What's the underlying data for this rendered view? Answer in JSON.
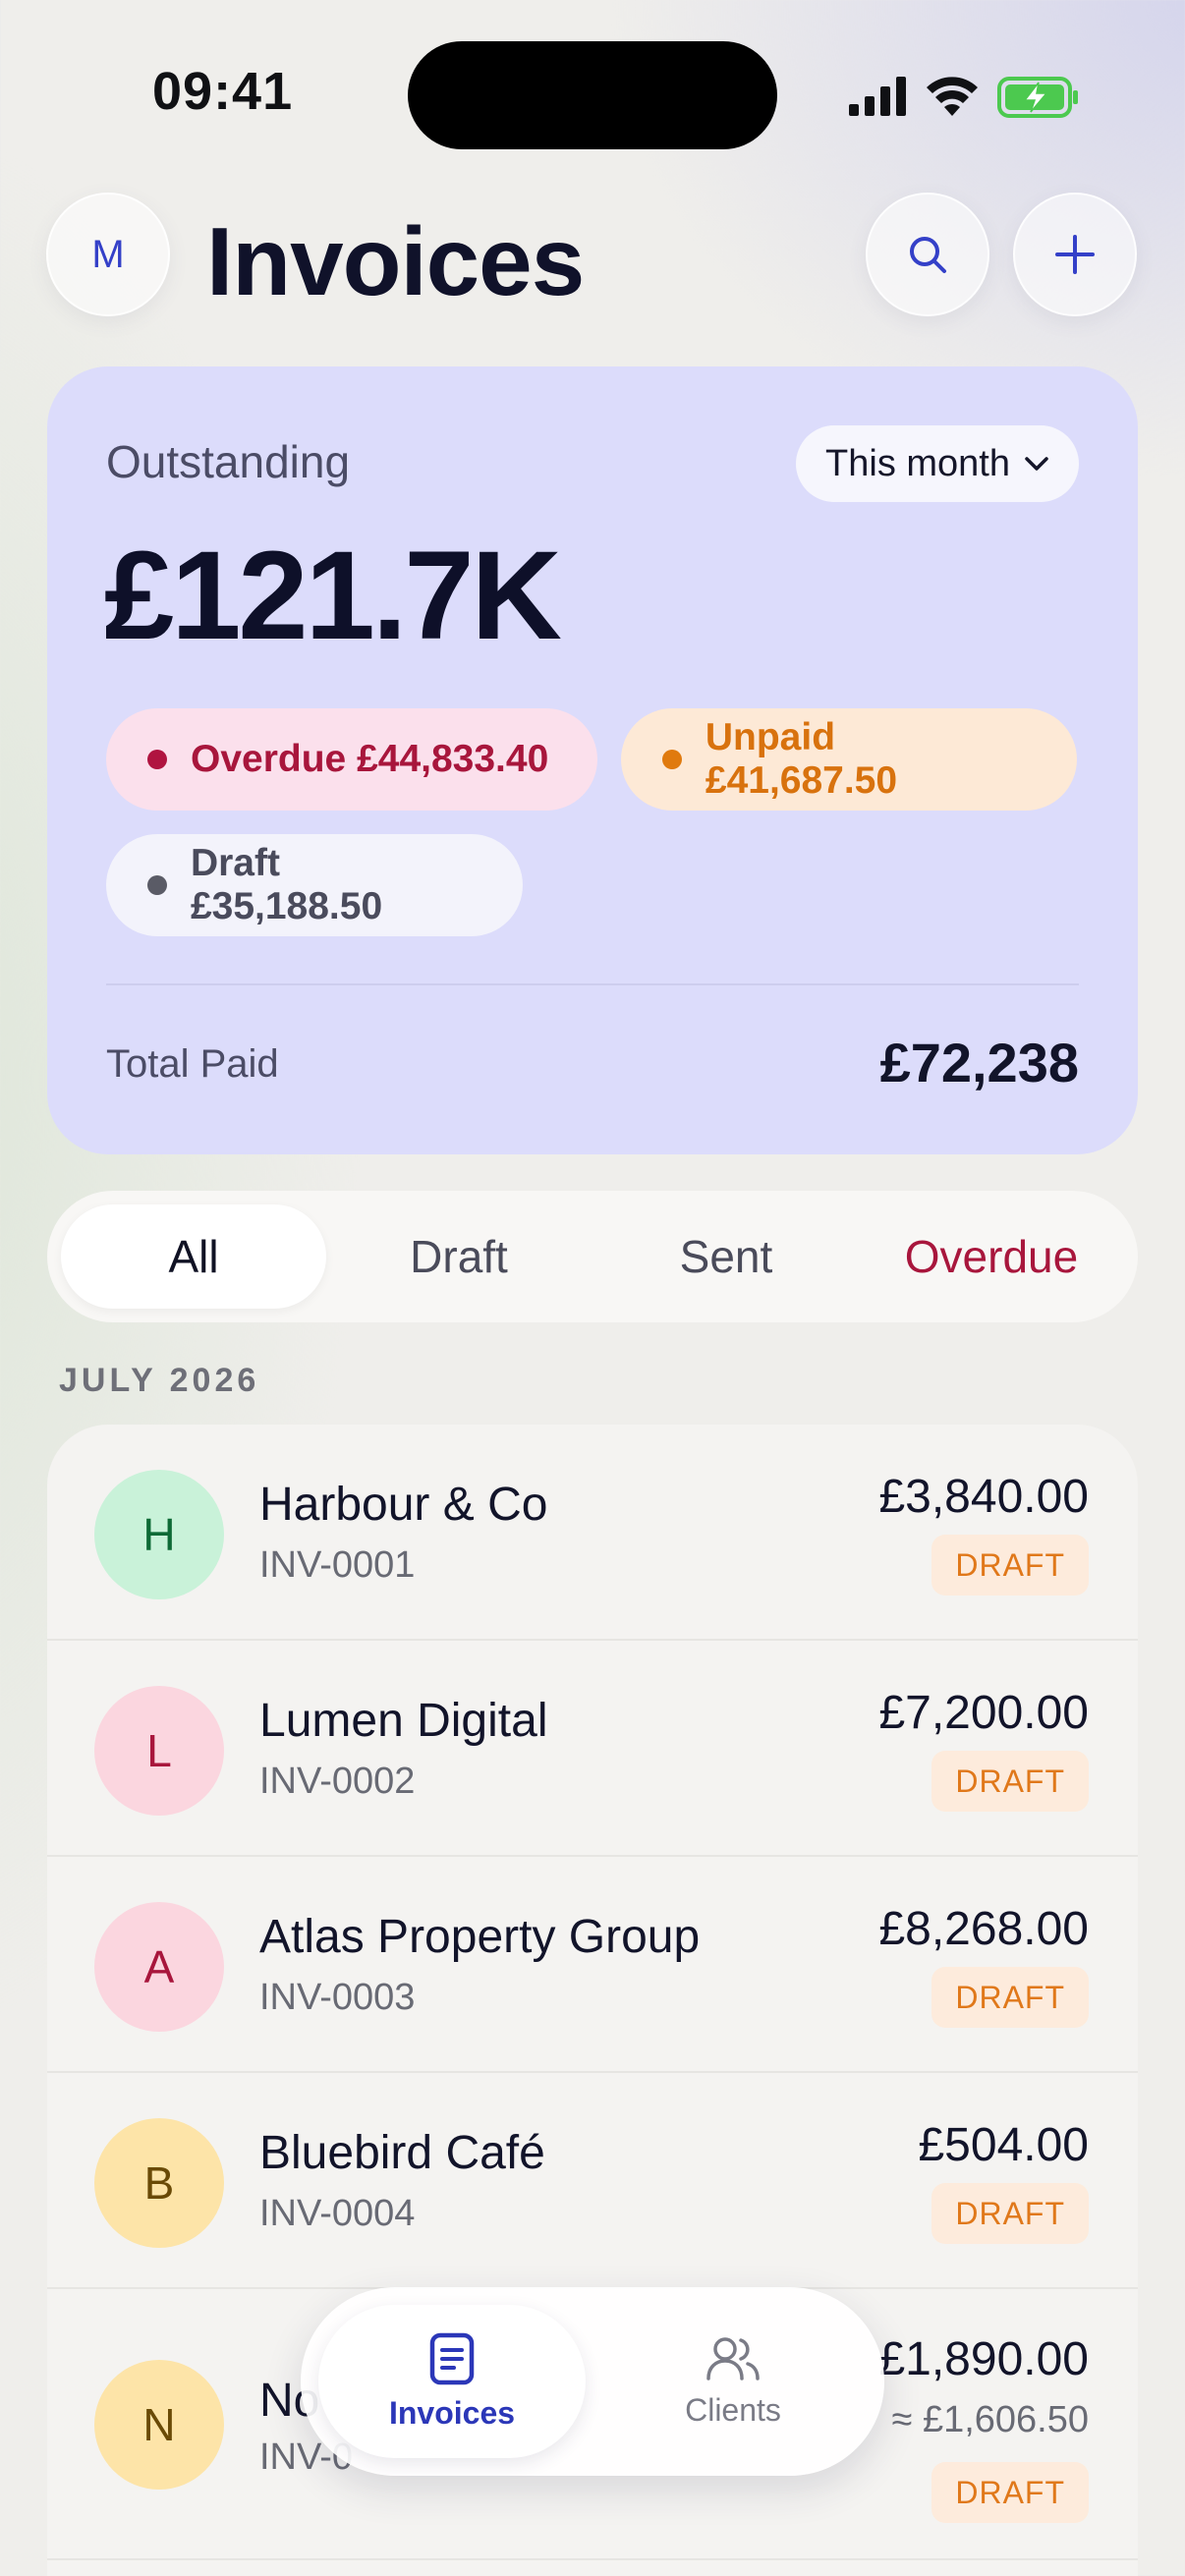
{
  "status_bar": {
    "time": "09:41"
  },
  "header": {
    "avatar_initial": "M",
    "title": "Invoices"
  },
  "summary": {
    "label": "Outstanding",
    "period_selector": "This month",
    "total": "£121.7K",
    "pills": [
      {
        "label": "Overdue £44,833.40",
        "color": "#b01440"
      },
      {
        "label": "Unpaid £41,687.50",
        "color": "#e07a0e"
      },
      {
        "label": "Draft £35,188.50",
        "color": "#5a5b66"
      }
    ],
    "paid_label": "Total Paid",
    "paid_value": "£72,238"
  },
  "filters": {
    "tabs": [
      "All",
      "Draft",
      "Sent",
      "Overdue"
    ],
    "active": "All"
  },
  "section_title": "JULY 2026",
  "invoices": [
    {
      "initial": "H",
      "name": "Harbour & Co",
      "number": "INV-0001",
      "amount": "£3,840.00",
      "status": "DRAFT",
      "avatar_bg": "#c9f2d9",
      "avatar_fg": "#0e6a36"
    },
    {
      "initial": "L",
      "name": "Lumen Digital",
      "number": "INV-0002",
      "amount": "£7,200.00",
      "status": "DRAFT",
      "avatar_bg": "#fbd6df",
      "avatar_fg": "#a8163c"
    },
    {
      "initial": "A",
      "name": "Atlas Property Group",
      "number": "INV-0003",
      "amount": "£8,268.00",
      "status": "DRAFT",
      "avatar_bg": "#fbd6df",
      "avatar_fg": "#a8163c"
    },
    {
      "initial": "B",
      "name": "Bluebird Café",
      "number": "INV-0004",
      "amount": "£504.00",
      "status": "DRAFT",
      "avatar_bg": "#fde4a8",
      "avatar_fg": "#6a4a06"
    },
    {
      "initial": "N",
      "name": "No",
      "number": "INV-0",
      "amount": "£1,890.00",
      "converted": "≈ £1,606.50",
      "status": "DRAFT",
      "avatar_bg": "#fde4a8",
      "avatar_fg": "#6a4a06"
    }
  ],
  "nav": {
    "invoices_label": "Invoices",
    "clients_label": "Clients"
  }
}
